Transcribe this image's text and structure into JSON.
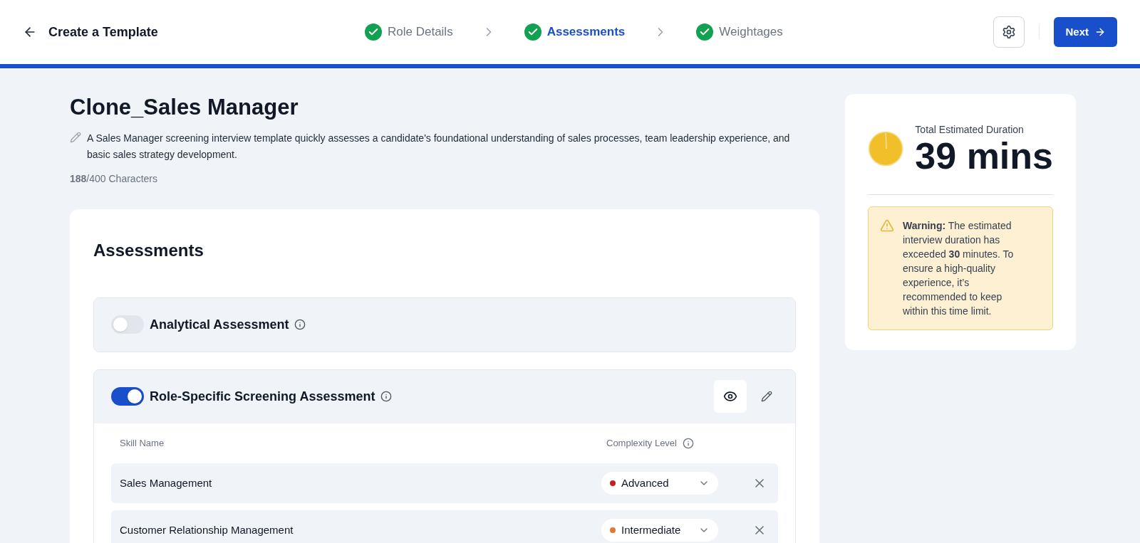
{
  "header": {
    "title": "Create a Template",
    "steps": [
      {
        "label": "Role Details",
        "completed": true,
        "selected": false
      },
      {
        "label": "Assessments",
        "completed": true,
        "selected": true
      },
      {
        "label": "Weightages",
        "completed": true,
        "selected": false
      }
    ],
    "next_button": "Next"
  },
  "progress": {
    "level": 1
  },
  "template": {
    "name": "Clone_Sales Manager",
    "description": "A Sales Manager screening interview template quickly assesses a candidate's foundational understanding of sales processes, team leadership experience, and basic sales strategy development.",
    "char_count": "188",
    "char_limit": "/400 Characters"
  },
  "assessments": {
    "heading": "Assessments",
    "items": [
      {
        "name": "Analytical Assessment",
        "on": false
      },
      {
        "name": "Role-Specific Screening Assessment",
        "on": true,
        "columns": [
          "Skill Name",
          "Complexity Level"
        ],
        "skills": [
          {
            "name": "Sales Management",
            "level": "Advanced",
            "color": "#c81e1e"
          },
          {
            "name": "Customer Relationship Management",
            "level": "Intermediate",
            "color": "#e07a2f"
          }
        ]
      }
    ]
  },
  "duration": {
    "label": "Total Estimated Duration",
    "value": "39 mins",
    "warning": "**Warning:** The estimated interview duration has exceeded **30** minutes. To ensure a high-quality experience, it’s recommended to keep within this time limit."
  }
}
